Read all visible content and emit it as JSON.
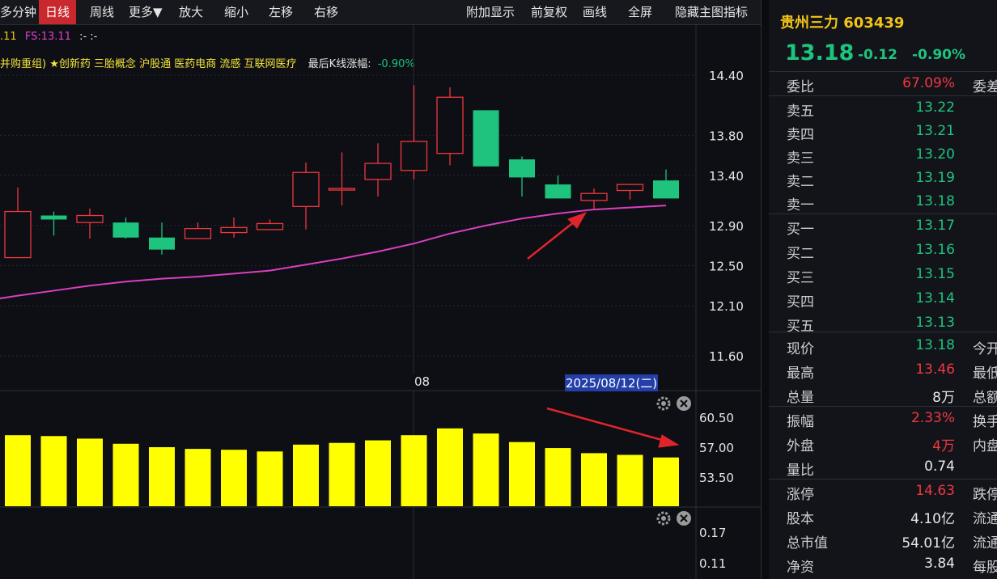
{
  "toolbar": {
    "left_items": [
      "多分钟",
      "日线",
      "周线",
      "更多▼",
      "放大",
      "缩小",
      "左移",
      "右移"
    ],
    "active": "日线",
    "right_items": [
      "附加显示",
      "前复权",
      "画线",
      "全屏",
      "隐藏主图指标"
    ]
  },
  "info": {
    "line1_prefix": ".11",
    "line1_fs": "FS:13.11",
    "line1_rest": ":-  :-",
    "concepts": "并购重组) ★创新药 三胎概念 沪股通 医药电商 流感 互联网医疗",
    "last_k_label": "最后K线涨幅:",
    "last_k_value": "-0.90%"
  },
  "colors": {
    "up": "#f0373f",
    "down": "#1ec47e",
    "ma": "#d93fc0",
    "volume": "#ffff00",
    "accent_name": "#f3c515",
    "bg": "#0d0f14"
  },
  "chart_data": [
    {
      "type": "candlestick",
      "y_ticks": [
        "14.40",
        "13.80",
        "13.40",
        "12.90",
        "12.50",
        "12.10",
        "11.60"
      ],
      "ylim": [
        11.6,
        14.4
      ],
      "x_label": "08",
      "cursor_date": "2025/08/12(二)",
      "candles": [
        {
          "open": 12.58,
          "close": 13.04,
          "high": 13.28,
          "low": 12.58
        },
        {
          "open": 13.0,
          "close": 12.96,
          "high": 13.04,
          "low": 12.8
        },
        {
          "open": 12.93,
          "close": 13.0,
          "high": 13.07,
          "low": 12.77
        },
        {
          "open": 12.93,
          "close": 12.78,
          "high": 12.98,
          "low": 12.77
        },
        {
          "open": 12.78,
          "close": 12.66,
          "high": 12.93,
          "low": 12.61
        },
        {
          "open": 12.77,
          "close": 12.87,
          "high": 12.93,
          "low": 12.77
        },
        {
          "open": 12.83,
          "close": 12.88,
          "high": 12.98,
          "low": 12.78
        },
        {
          "open": 12.86,
          "close": 12.92,
          "high": 12.96,
          "low": 12.86
        },
        {
          "open": 13.09,
          "close": 13.43,
          "high": 13.53,
          "low": 12.86
        },
        {
          "open": 13.27,
          "close": 13.27,
          "high": 13.63,
          "low": 13.1
        },
        {
          "open": 13.36,
          "close": 13.52,
          "high": 13.72,
          "low": 13.19
        },
        {
          "open": 13.45,
          "close": 13.74,
          "high": 14.3,
          "low": 13.36
        },
        {
          "open": 13.62,
          "close": 14.18,
          "high": 14.28,
          "low": 13.5
        },
        {
          "open": 14.05,
          "close": 13.49,
          "high": 14.05,
          "low": 13.49
        },
        {
          "open": 13.56,
          "close": 13.38,
          "high": 13.59,
          "low": 13.19
        },
        {
          "open": 13.31,
          "close": 13.17,
          "high": 13.4,
          "low": 13.17
        },
        {
          "open": 13.15,
          "close": 13.22,
          "high": 13.27,
          "low": 13.06
        },
        {
          "open": 13.25,
          "close": 13.31,
          "high": 13.31,
          "low": 13.16
        },
        {
          "open": 13.35,
          "close": 13.17,
          "high": 13.46,
          "low": 13.17
        }
      ],
      "ma": [
        12.2,
        12.25,
        12.3,
        12.34,
        12.37,
        12.39,
        12.42,
        12.45,
        12.51,
        12.57,
        12.64,
        12.72,
        12.82,
        12.9,
        12.97,
        13.02,
        13.06,
        13.08,
        13.1
      ]
    },
    {
      "type": "bar",
      "y_ticks": [
        "60.50",
        "57.00",
        "53.50"
      ],
      "ylim": [
        50.0,
        62.0
      ],
      "values": [
        58.4,
        58.3,
        58.0,
        57.4,
        57.0,
        56.8,
        56.7,
        56.5,
        57.3,
        57.5,
        57.8,
        58.4,
        59.2,
        58.6,
        57.6,
        56.9,
        56.3,
        56.1,
        55.8
      ]
    },
    {
      "type": "indicator",
      "y_ticks": [
        "0.17",
        "0.11"
      ]
    }
  ],
  "panel": {
    "stock_name": "贵州三力 603439",
    "price": "13.18",
    "change": "-0.12",
    "change_pct": "-0.90%",
    "ratio_label": "委比",
    "ratio_value": "67.09%",
    "ratio_right": "委差",
    "sell": [
      {
        "label": "卖五",
        "price": "13.22"
      },
      {
        "label": "卖四",
        "price": "13.21"
      },
      {
        "label": "卖三",
        "price": "13.20"
      },
      {
        "label": "卖二",
        "price": "13.19"
      },
      {
        "label": "卖一",
        "price": "13.18"
      }
    ],
    "buy": [
      {
        "label": "买一",
        "price": "13.17"
      },
      {
        "label": "买二",
        "price": "13.16"
      },
      {
        "label": "买三",
        "price": "13.15"
      },
      {
        "label": "买四",
        "price": "13.14"
      },
      {
        "label": "买五",
        "price": "13.13"
      }
    ],
    "stats": [
      {
        "label": "现价",
        "value": "13.18",
        "color": "g",
        "right": "今开"
      },
      {
        "label": "最高",
        "value": "13.46",
        "color": "r",
        "right": "最低"
      },
      {
        "label": "总量",
        "value": "8万",
        "color": "w",
        "right": "总额"
      },
      {
        "label": "振幅",
        "value": "2.33%",
        "color": "r",
        "right": "换手"
      },
      {
        "label": "外盘",
        "value": "4万",
        "color": "r",
        "right": "内盘"
      },
      {
        "label": "量比",
        "value": "0.74",
        "color": "w",
        "right": ""
      },
      {
        "label": "涨停",
        "value": "14.63",
        "color": "r",
        "right": "跌停"
      },
      {
        "label": "股本",
        "value": "4.10亿",
        "color": "w",
        "right": "流通"
      },
      {
        "label": "总市值",
        "value": "54.01亿",
        "color": "w",
        "right": "流通"
      },
      {
        "label": "净资",
        "value": "3.84",
        "color": "w",
        "right": "每股"
      }
    ]
  }
}
